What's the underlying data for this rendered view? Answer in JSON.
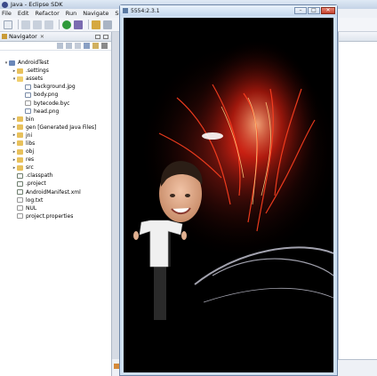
{
  "window": {
    "title": "Java - Eclipse SDK"
  },
  "menu": [
    "File",
    "Edit",
    "Refactor",
    "Run",
    "Navigate",
    "Search"
  ],
  "navigator": {
    "tab_label": "Navigator",
    "tree": [
      {
        "label": "AndroidTest",
        "icon": "project-icon",
        "level": 0,
        "expanded": true
      },
      {
        "label": ".settings",
        "icon": "folder-icon",
        "level": 1,
        "expanded": false
      },
      {
        "label": "assets",
        "icon": "folder-icon",
        "level": 1,
        "expanded": true
      },
      {
        "label": "background.jpg",
        "icon": "image-file-icon",
        "level": 2
      },
      {
        "label": "body.png",
        "icon": "image-file-icon",
        "level": 2
      },
      {
        "label": "bytecode.byc",
        "icon": "file-icon",
        "level": 2
      },
      {
        "label": "head.png",
        "icon": "image-file-icon",
        "level": 2
      },
      {
        "label": "bin",
        "icon": "folder-icon",
        "level": 1,
        "expanded": false
      },
      {
        "label": "gen [Generated Java Files]",
        "icon": "folder-icon",
        "level": 1,
        "expanded": false
      },
      {
        "label": "jni",
        "icon": "folder-icon",
        "level": 1,
        "expanded": false
      },
      {
        "label": "libs",
        "icon": "folder-icon",
        "level": 1,
        "expanded": false
      },
      {
        "label": "obj",
        "icon": "folder-icon",
        "level": 1,
        "expanded": false
      },
      {
        "label": "res",
        "icon": "folder-icon",
        "level": 1,
        "expanded": false
      },
      {
        "label": "src",
        "icon": "folder-icon",
        "level": 1,
        "expanded": false
      },
      {
        "label": ".classpath",
        "icon": "xml-file-icon",
        "level": 1
      },
      {
        "label": ".project",
        "icon": "xml-file-icon",
        "level": 1
      },
      {
        "label": "AndroidManifest.xml",
        "icon": "xml-file-icon",
        "level": 1
      },
      {
        "label": "log.txt",
        "icon": "file-icon",
        "level": 1
      },
      {
        "label": "NUL",
        "icon": "file-icon",
        "level": 1
      },
      {
        "label": "project.properties",
        "icon": "file-icon",
        "level": 1
      }
    ]
  },
  "emulator": {
    "title": "5554:2.3.1",
    "buttons": [
      "minimize",
      "maximize",
      "close"
    ]
  },
  "colors": {
    "title_bar": "#c4d3e6",
    "selection": "#3399ff",
    "screen_bg": "#000000"
  }
}
